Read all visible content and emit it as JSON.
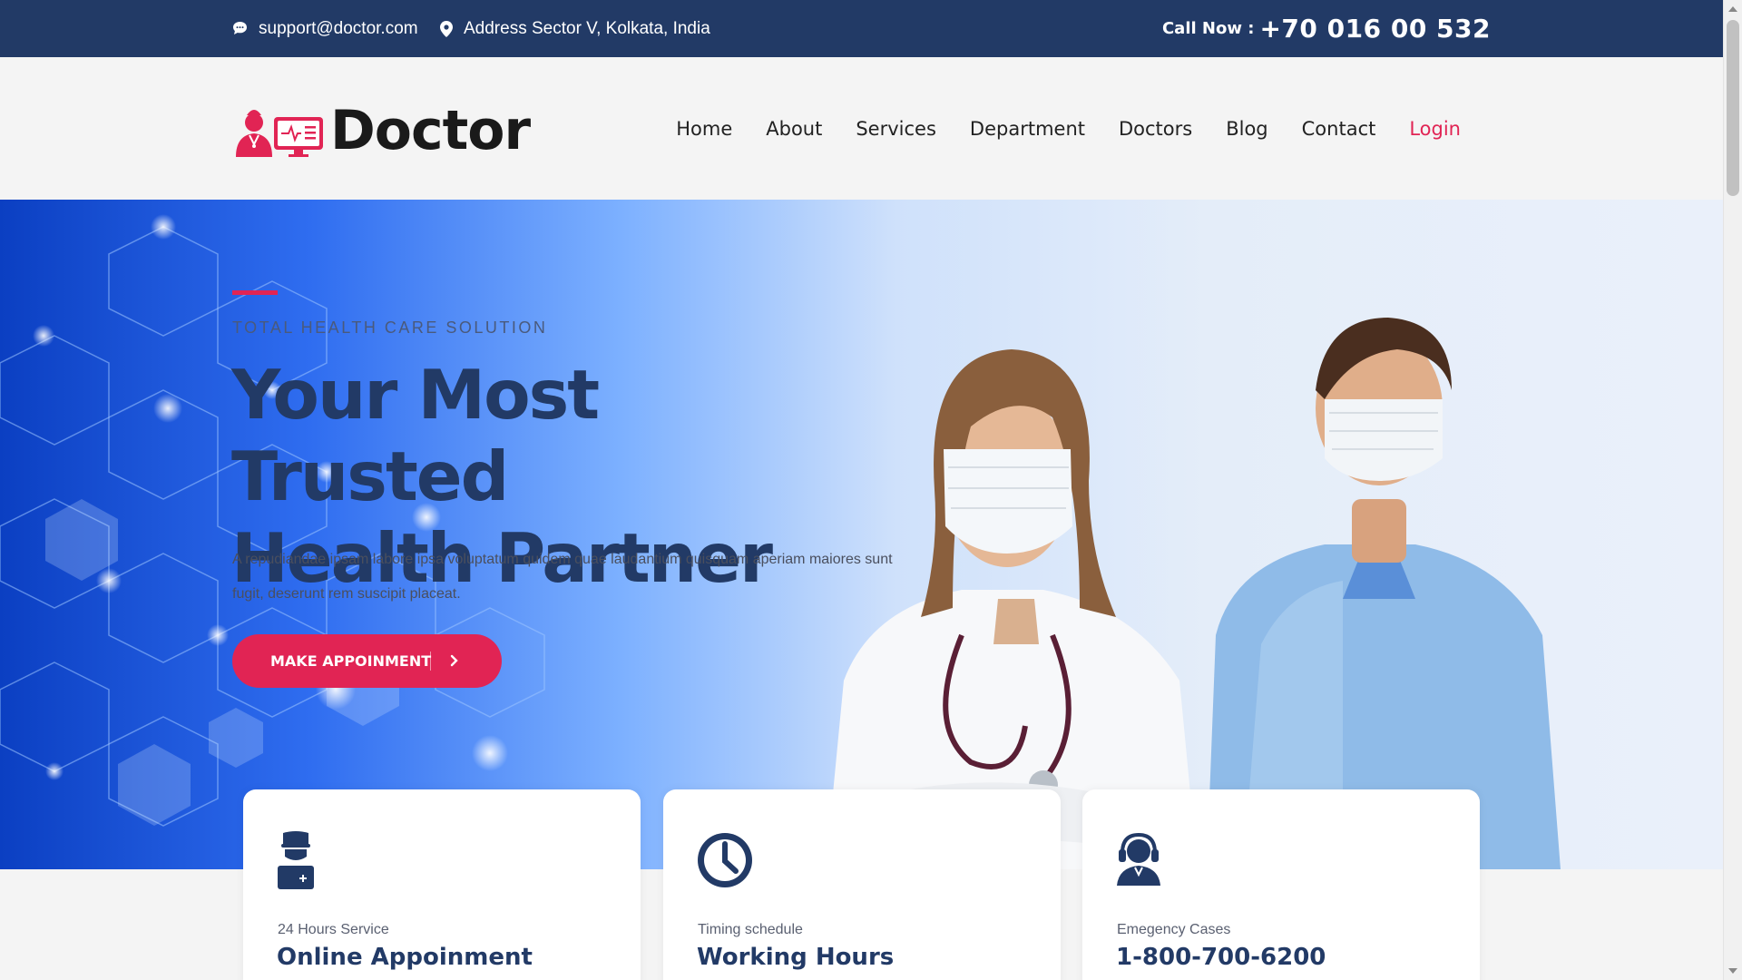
{
  "topbar": {
    "email": "support@doctor.com",
    "address": "Address Sector V, Kolkata, India",
    "call_label": "Call Now :",
    "call_number": "+70 016 00 532"
  },
  "header": {
    "logo_text": "Doctor",
    "nav": [
      "Home",
      "About",
      "Services",
      "Department",
      "Doctors",
      "Blog",
      "Contact",
      "Login"
    ]
  },
  "hero": {
    "subtitle": "TOTAL HEALTH CARE SOLUTION",
    "title_line1": "Your Most Trusted",
    "title_line2": "Health Partner",
    "description": "A repudiandae ipsam labore ipsa voluptatum quidem quae laudantium quisquam aperiam maiores sunt fugit, deserunt rem suscipit placeat.",
    "cta_label": "MAKE APPOINMENT"
  },
  "features": [
    {
      "icon": "doctor-icon",
      "small": "24 Hours Service",
      "big": "Online Appoinment"
    },
    {
      "icon": "clock-icon",
      "small": "Timing schedule",
      "big": "Working Hours"
    },
    {
      "icon": "headset-icon",
      "small": "Emegency Cases",
      "big": "1-800-700-6200"
    }
  ],
  "colors": {
    "primary": "#223a66",
    "accent": "#e12454"
  }
}
